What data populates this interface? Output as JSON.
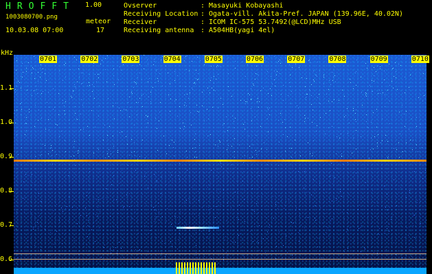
{
  "header": {
    "app_name": "HROFFT",
    "version": "1.00",
    "file_name": "1003080700.png",
    "datetime": "10.03.08 07:00",
    "meteor_label": "meteor",
    "meteor_count": "17"
  },
  "info": [
    {
      "label": "Ovserver",
      "value": "Masayuki Kobayashi"
    },
    {
      "label": "Receiving Location",
      "value": "Ogata-vill. Akita-Pref. JAPAN (139.96E, 40.02N)"
    },
    {
      "label": "Receiver",
      "value": "ICOM IC-575 53.7492(@LCD)MHz USB"
    },
    {
      "label": "Receiving antenna",
      "value": "A504HB(yagi 4el)"
    }
  ],
  "colon": ":",
  "plot": {
    "y_unit": "kHz",
    "y_ticks": [
      "1.1",
      "1.0",
      "0.9",
      "0.8",
      "0.7",
      "0.6"
    ],
    "time_ticks": [
      "0701",
      "0702",
      "0703",
      "0704",
      "0705",
      "0706",
      "0707",
      "0708",
      "0709",
      "0710"
    ],
    "colors": {
      "background": "#000000",
      "text_green": "#33ff33",
      "text_yellow": "#ffff00",
      "noise_blue": "#1b5bd4",
      "carrier": "#ff9000"
    }
  }
}
